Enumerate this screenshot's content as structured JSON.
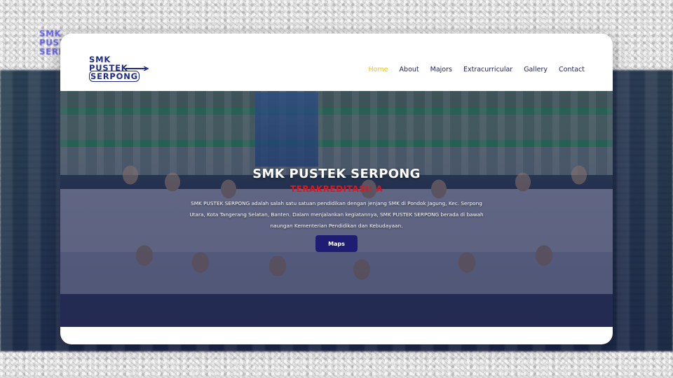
{
  "background_logo": {
    "lines": [
      "SMK",
      "PUSTEK",
      "SERPONG"
    ]
  },
  "logo": {
    "line1": "SMK",
    "line2": "PUSTEK",
    "line3": "SERPONG",
    "color": "#1e2a8c"
  },
  "nav": {
    "items": [
      {
        "label": "Home",
        "active": true
      },
      {
        "label": "About"
      },
      {
        "label": "Majors"
      },
      {
        "label": "Extracurricular"
      },
      {
        "label": "Gallery"
      },
      {
        "label": "Contact"
      }
    ],
    "active_color": "#f2c400",
    "text_color": "#1a1f5c"
  },
  "hero": {
    "title": "SMK PUSTEK SERPONG",
    "subtitle": "TERAKREDITASI: A",
    "description": "SMK PUSTEK SERPONG adalah salah satu satuan pendidikan dengan jenjang SMK di Pondok Jagung, Kec. Serpong Utara, Kota Tangerang Selatan, Banten. Dalam menjalankan kegiatannya, SMK PUSTEK SERPONG berada di bawah naungan Kementerian Pendidikan dan Kebudayaan.",
    "button_label": "Maps",
    "subtitle_color": "#e4141b",
    "button_color": "#1f1d73"
  }
}
